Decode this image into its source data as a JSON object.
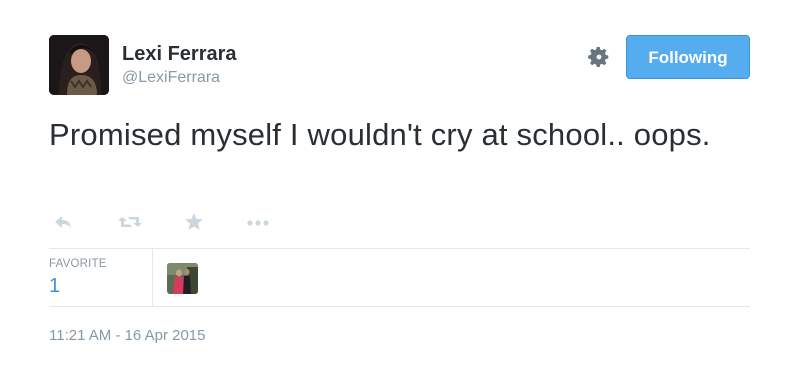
{
  "author": {
    "name": "Lexi Ferrara",
    "handle": "@LexiFerrara",
    "avatar_icon": "profile-photo"
  },
  "header": {
    "settings_icon": "gear-icon",
    "follow_button_label": "Following",
    "follow_button_color": "#55acee"
  },
  "tweet": {
    "text": "Promised myself I wouldn't cry at school.. oops."
  },
  "actions": [
    {
      "name": "reply",
      "icon": "reply-arrow"
    },
    {
      "name": "retweet",
      "icon": "retweet-arrows"
    },
    {
      "name": "favorite",
      "icon": "star"
    },
    {
      "name": "more",
      "icon": "ellipsis"
    }
  ],
  "stats": {
    "label": "FAVORITE",
    "count": "1",
    "count_color": "#3b94d9"
  },
  "timestamp": "11:21 AM - 16 Apr 2015"
}
